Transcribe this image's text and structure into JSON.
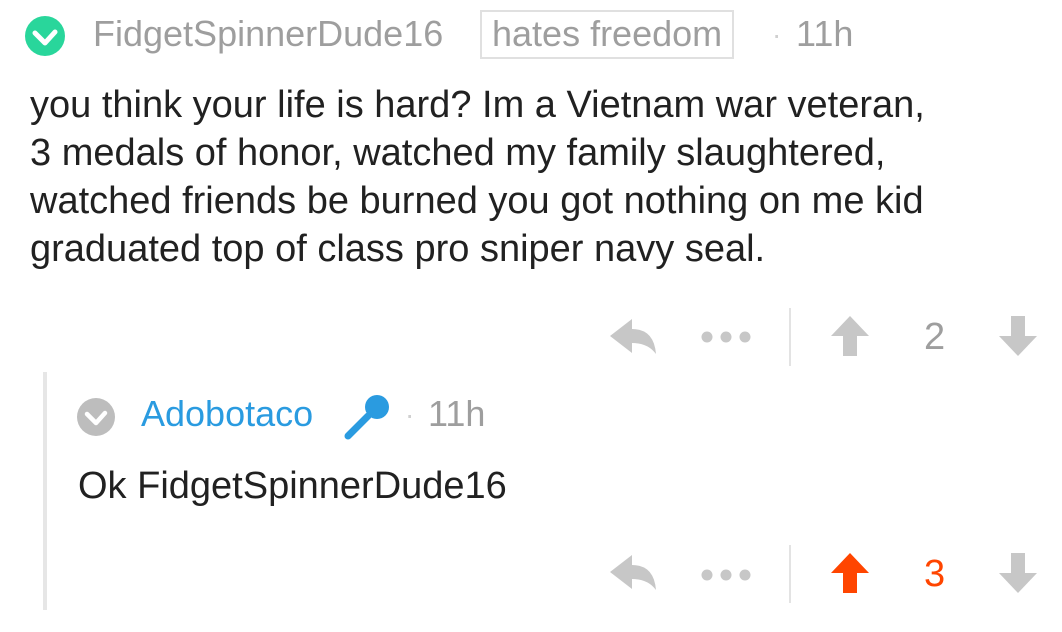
{
  "comment": {
    "author": "FidgetSpinnerDude16",
    "flair": "hates freedom",
    "separator": "·",
    "time": "11h",
    "body_lines": [
      "you think your life is hard? Im a Vietnam war veteran,",
      "3 medals of honor, watched my family slaughtered,",
      "watched friends be burned you got nothing on me kid",
      "graduated top of class pro sniper navy seal."
    ],
    "score": "2",
    "colors": {
      "avatar": "#29d69b",
      "text": "#212121",
      "meta": "#9e9e9e",
      "icon": "#c7c7c7"
    },
    "icons": {
      "avatar": "check-circle-icon",
      "reply": "reply-arrow-icon",
      "more": "more-dots-icon",
      "upvote": "upvote-arrow-icon",
      "downvote": "downvote-arrow-icon"
    }
  },
  "reply": {
    "author": "Adobotaco",
    "separator": "·",
    "time": "11h",
    "body": "Ok FidgetSpinnerDude16",
    "score": "3",
    "upvoted": true,
    "colors": {
      "author": "#2a9be0",
      "upvote": "#ff4500",
      "avatar": "#bdbdbd"
    },
    "icons": {
      "avatar": "check-circle-icon",
      "badge": "microphone-icon"
    }
  }
}
